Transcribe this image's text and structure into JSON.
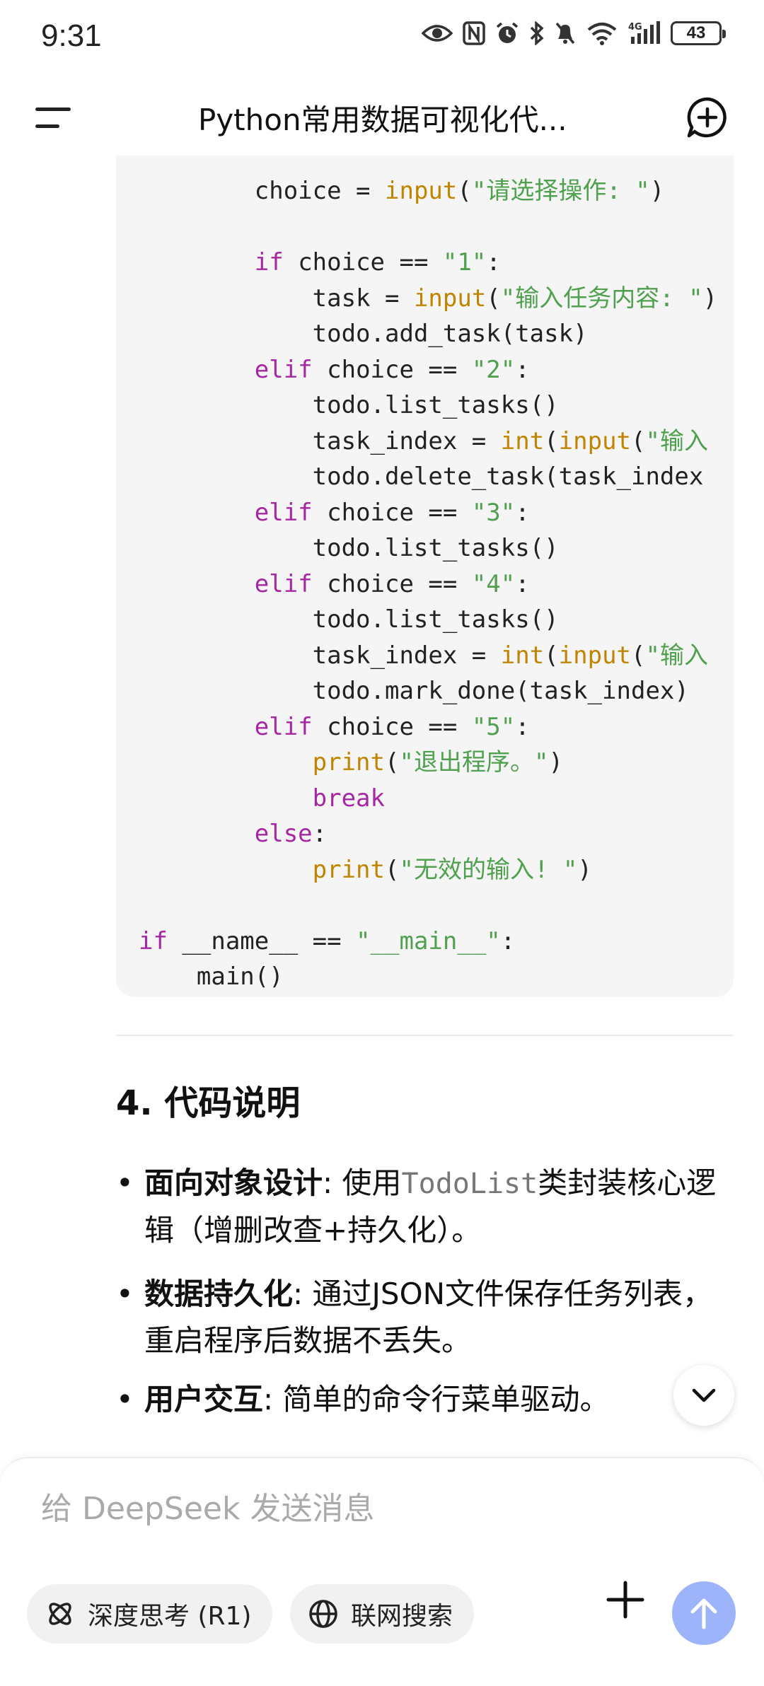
{
  "status_bar": {
    "time": "9:31",
    "battery": "43"
  },
  "header": {
    "title": "Python常用数据可视化代..."
  },
  "code": {
    "lines": [
      [
        {
          "t": "        choice = "
        },
        {
          "t": "input",
          "c": "fn"
        },
        {
          "t": "("
        },
        {
          "t": "\"请选择操作: \"",
          "c": "str"
        },
        {
          "t": ")"
        }
      ],
      [],
      [
        {
          "t": "        "
        },
        {
          "t": "if",
          "c": "kw"
        },
        {
          "t": " choice == "
        },
        {
          "t": "\"1\"",
          "c": "str"
        },
        {
          "t": ":"
        }
      ],
      [
        {
          "t": "            task = "
        },
        {
          "t": "input",
          "c": "fn"
        },
        {
          "t": "("
        },
        {
          "t": "\"输入任务内容: \"",
          "c": "str"
        },
        {
          "t": ")"
        }
      ],
      [
        {
          "t": "            todo.add_task(task)"
        }
      ],
      [
        {
          "t": "        "
        },
        {
          "t": "elif",
          "c": "kw"
        },
        {
          "t": " choice == "
        },
        {
          "t": "\"2\"",
          "c": "str"
        },
        {
          "t": ":"
        }
      ],
      [
        {
          "t": "            todo.list_tasks()"
        }
      ],
      [
        {
          "t": "            task_index = "
        },
        {
          "t": "int",
          "c": "fn"
        },
        {
          "t": "("
        },
        {
          "t": "input",
          "c": "fn"
        },
        {
          "t": "("
        },
        {
          "t": "\"输入",
          "c": "str"
        }
      ],
      [
        {
          "t": "            todo.delete_task(task_index"
        }
      ],
      [
        {
          "t": "        "
        },
        {
          "t": "elif",
          "c": "kw"
        },
        {
          "t": " choice == "
        },
        {
          "t": "\"3\"",
          "c": "str"
        },
        {
          "t": ":"
        }
      ],
      [
        {
          "t": "            todo.list_tasks()"
        }
      ],
      [
        {
          "t": "        "
        },
        {
          "t": "elif",
          "c": "kw"
        },
        {
          "t": " choice == "
        },
        {
          "t": "\"4\"",
          "c": "str"
        },
        {
          "t": ":"
        }
      ],
      [
        {
          "t": "            todo.list_tasks()"
        }
      ],
      [
        {
          "t": "            task_index = "
        },
        {
          "t": "int",
          "c": "fn"
        },
        {
          "t": "("
        },
        {
          "t": "input",
          "c": "fn"
        },
        {
          "t": "("
        },
        {
          "t": "\"输入",
          "c": "str"
        }
      ],
      [
        {
          "t": "            todo.mark_done(task_index)"
        }
      ],
      [
        {
          "t": "        "
        },
        {
          "t": "elif",
          "c": "kw"
        },
        {
          "t": " choice == "
        },
        {
          "t": "\"5\"",
          "c": "str"
        },
        {
          "t": ":"
        }
      ],
      [
        {
          "t": "            "
        },
        {
          "t": "print",
          "c": "fn"
        },
        {
          "t": "("
        },
        {
          "t": "\"退出程序。\"",
          "c": "str"
        },
        {
          "t": ")"
        }
      ],
      [
        {
          "t": "            "
        },
        {
          "t": "break",
          "c": "kw"
        }
      ],
      [
        {
          "t": "        "
        },
        {
          "t": "else",
          "c": "kw"
        },
        {
          "t": ":"
        }
      ],
      [
        {
          "t": "            "
        },
        {
          "t": "print",
          "c": "fn"
        },
        {
          "t": "("
        },
        {
          "t": "\"无效的输入! \"",
          "c": "str"
        },
        {
          "t": ")"
        }
      ],
      [],
      [
        {
          "t": "if",
          "c": "kw"
        },
        {
          "t": " __name__ == "
        },
        {
          "t": "\"__main__\"",
          "c": "str"
        },
        {
          "t": ":"
        }
      ],
      [
        {
          "t": "    main()"
        }
      ]
    ]
  },
  "section": {
    "heading": "4. 代码说明"
  },
  "bullets": [
    {
      "bold": "面向对象设计",
      "sep": ": ",
      "pre": "使用",
      "code": "TodoList",
      "post": "类封装核心逻辑（增删改查+持久化）。"
    },
    {
      "bold": "数据持久化",
      "sep": ": ",
      "pre": "通过JSON文件保存任务列表，重启程序后数据不丢失。",
      "code": "",
      "post": ""
    },
    {
      "bold": "用户交互",
      "sep": ": ",
      "pre": "简单的命令行菜单驱动。",
      "code": "",
      "post": ""
    }
  ],
  "composer": {
    "placeholder": "给 DeepSeek 发送消息",
    "deep_think_label": "深度思考 (R1)",
    "web_search_label": "联网搜索"
  },
  "colors": {
    "keyword": "#a626a4",
    "builtin": "#c18401",
    "string": "#50a14f",
    "send_button": "#9db4fb"
  }
}
